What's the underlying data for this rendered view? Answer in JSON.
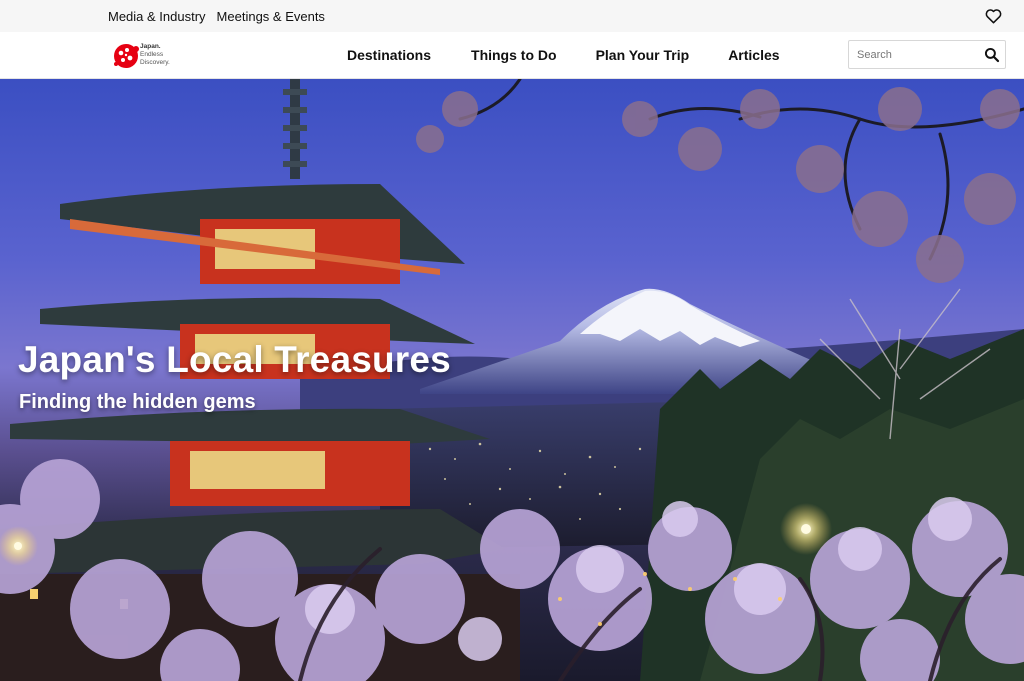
{
  "utility_bar": {
    "links": [
      "Media & Industry",
      "Meetings & Events"
    ]
  },
  "logo": {
    "line1": "Japan.",
    "line2": "Endless",
    "line3": "Discovery."
  },
  "nav": {
    "items": [
      "Destinations",
      "Things to Do",
      "Plan Your Trip",
      "Articles"
    ]
  },
  "search": {
    "placeholder": "Search",
    "value": ""
  },
  "hero": {
    "title": "Japan's Local Treasures",
    "subtitle": "Finding the hidden gems"
  },
  "icons": {
    "favorites": "heart-icon",
    "search": "search-icon",
    "logo": "cherry-blossom-logo-icon"
  },
  "colors": {
    "brand_red": "#e60012",
    "nav_text": "#111111",
    "sky": "#4a5bc9",
    "blossom": "#c9b6e6",
    "pagoda": "#c8321e"
  }
}
